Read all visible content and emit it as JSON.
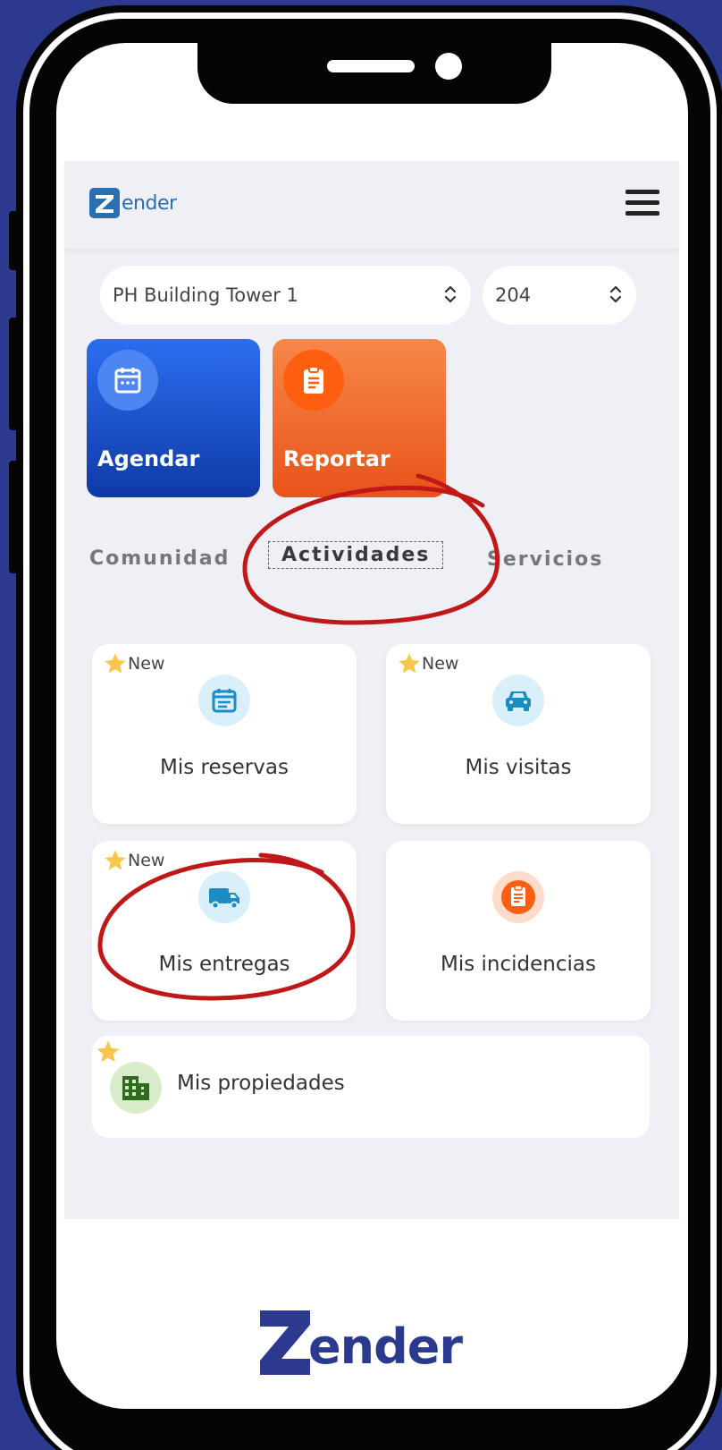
{
  "header": {
    "logo_text": "ender"
  },
  "selectors": {
    "building": "PH Building Tower 1",
    "unit": "204"
  },
  "quick_actions": [
    {
      "label": "Agendar"
    },
    {
      "label": "Reportar"
    }
  ],
  "tabs": [
    {
      "label": "Comunidad"
    },
    {
      "label": "Actividades"
    },
    {
      "label": "Servicios"
    }
  ],
  "cards": [
    {
      "label": "Mis reservas",
      "badge": "New"
    },
    {
      "label": "Mis visitas",
      "badge": "New"
    },
    {
      "label": "Mis entregas",
      "badge": "New"
    },
    {
      "label": "Mis incidencias"
    },
    {
      "label": "Mis propiedades"
    }
  ],
  "footer": {
    "logo_text": "ender"
  },
  "colors": {
    "background": "#2b3a8f",
    "accent_blue": "#1f6ff0",
    "accent_orange": "#fd5e10",
    "annotation_red": "#c01818",
    "star": "#f8c64a"
  },
  "icons": {
    "menu": "hamburger-icon",
    "agendar": "calendar-icon",
    "reportar": "clipboard-icon",
    "reservas": "calendar-icon",
    "visitas": "car-icon",
    "entregas": "truck-icon",
    "incidencias": "clipboard-icon",
    "propiedades": "building-icon",
    "badge": "star-icon"
  }
}
